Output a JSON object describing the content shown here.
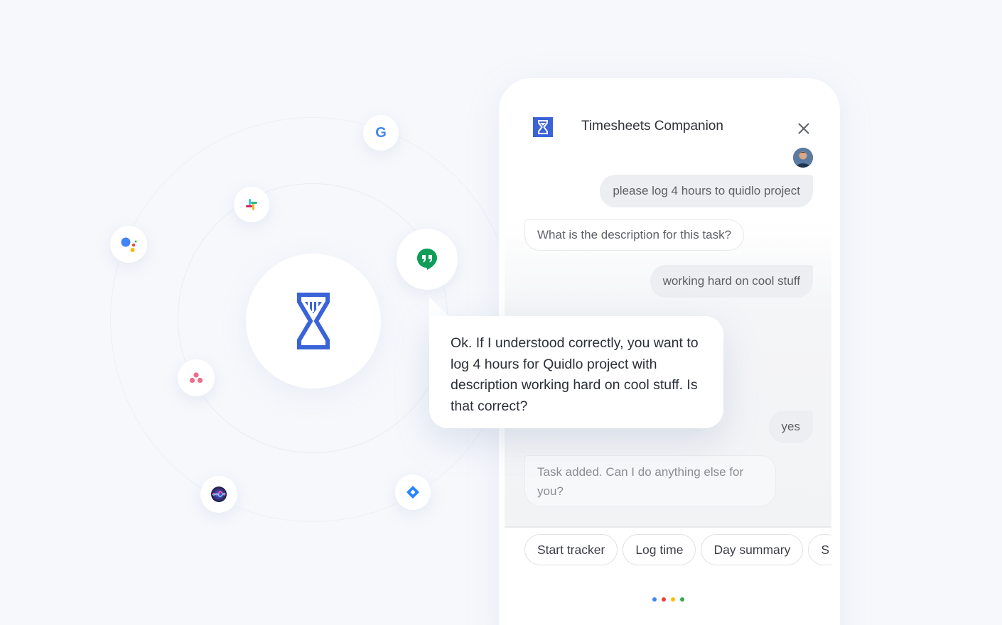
{
  "assistant": {
    "title": "Timesheets Companion",
    "close_icon": "close-icon",
    "logo_icon": "hourglass-logo-icon"
  },
  "integrations": {
    "hub_icon": "hourglass-logo-icon",
    "google_letter": "G",
    "items": [
      "google-icon",
      "slack-icon",
      "google-assistant-icon",
      "hangouts-icon",
      "asana-icon",
      "siri-icon",
      "jira-icon"
    ]
  },
  "conversation": {
    "user_1": "please log 4 hours to quidlo project",
    "bot_1": "What is the description for this task?",
    "user_2": "working hard on cool stuff",
    "bot_confirm": "Ok. If I understood correctly, you want to log 4 hours for Quidlo project with description working hard on cool stuff. Is that correct?",
    "user_3": "yes",
    "bot_2": "Task added. Can I do anything else for you?"
  },
  "suggestions": [
    "Start tracker",
    "Log time",
    "Day summary",
    "S"
  ],
  "colors": {
    "brand_blue": "#3b63d8",
    "google_blue": "#4285f4",
    "google_red": "#ea4335",
    "google_yellow": "#fbbc04",
    "google_green": "#34a853",
    "hangouts_green": "#0f9d58",
    "asana_pink": "#f06a8a",
    "jira_blue": "#2684ff"
  }
}
